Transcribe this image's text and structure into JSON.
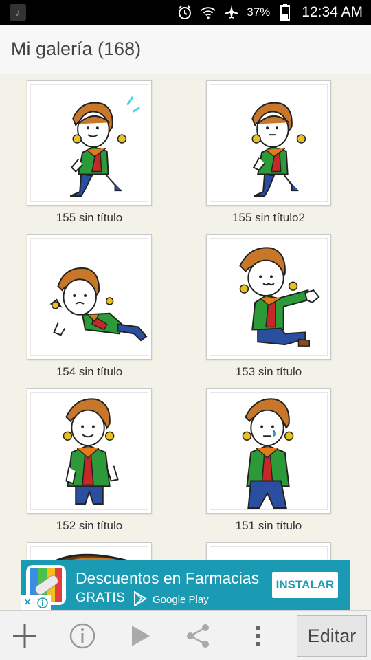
{
  "status_bar": {
    "battery_percent": "37%",
    "time": "12:34 AM",
    "icons": [
      "music-app-icon",
      "alarm-icon",
      "wifi-icon",
      "airplane-icon",
      "battery-icon"
    ]
  },
  "header": {
    "title": "Mi galería (168)"
  },
  "gallery": {
    "items": [
      {
        "caption": "155 sin título",
        "figure": "standing-sweat"
      },
      {
        "caption": "155 sin título2",
        "figure": "standing"
      },
      {
        "caption": "154 sin título",
        "figure": "fallen"
      },
      {
        "caption": "153 sin título",
        "figure": "pointing"
      },
      {
        "caption": "152 sin título",
        "figure": "front"
      },
      {
        "caption": "151 sin título",
        "figure": "front-tear"
      },
      {
        "caption": "",
        "figure": "partial"
      },
      {
        "caption": "",
        "figure": "blank"
      }
    ]
  },
  "ad": {
    "title": "Descuentos en Farmacias",
    "subtitle": "GRATIS",
    "store": "Google Play",
    "install_label": "INSTALAR",
    "close_glyph": "✕",
    "colors": {
      "background": "#1a9ab3",
      "button_text": "#1a9ab3"
    }
  },
  "toolbar": {
    "buttons": [
      "add-icon",
      "info-icon",
      "play-icon",
      "share-icon",
      "more-vert-icon"
    ],
    "edit_label": "Editar"
  }
}
